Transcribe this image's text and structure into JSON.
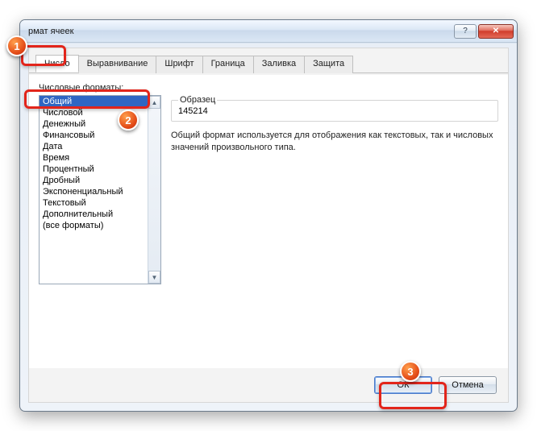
{
  "window": {
    "title": "рмат ячеек"
  },
  "tabs": [
    "Число",
    "Выравнивание",
    "Шрифт",
    "Граница",
    "Заливка",
    "Защита"
  ],
  "active_tab": "Число",
  "formats_label": "Числовые форматы:",
  "formats": [
    "Общий",
    "Числовой",
    "Денежный",
    "Финансовый",
    "Дата",
    "Время",
    "Процентный",
    "Дробный",
    "Экспоненциальный",
    "Текстовый",
    "Дополнительный",
    "(все форматы)"
  ],
  "selected_format": "Общий",
  "sample": {
    "label": "Образец",
    "value": "145214"
  },
  "description": "Общий формат используется для отображения как текстовых, так и числовых значений произвольного типа.",
  "buttons": {
    "ok": "ОК",
    "cancel": "Отмена"
  },
  "annotations": {
    "m1": "1",
    "m2": "2",
    "m3": "3"
  }
}
